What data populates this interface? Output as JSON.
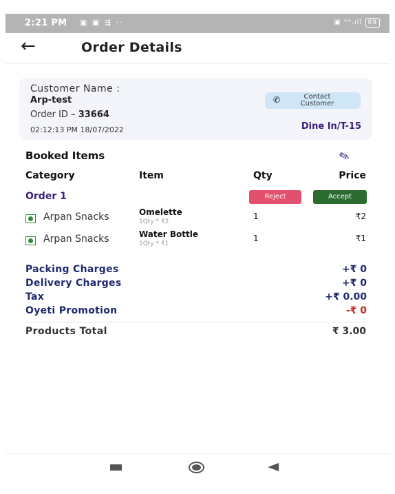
{
  "status_bar": {
    "time": "2:21 PM",
    "left_icons": "▣ ▣ ⇶ ··",
    "right_icons": "▣ ⁴ᴳ.ıll",
    "battery": "89"
  },
  "app_bar": {
    "back_icon": "arrow-left-icon",
    "title": "Order Details"
  },
  "customer_card": {
    "name_label": "Customer Name :",
    "name": "Arp-test",
    "order_id_label": "Order ID – ",
    "order_id": "33664",
    "datetime": "02:12:13 PM 18/07/2022",
    "contact_line1": "Contact",
    "contact_line2": "Customer",
    "dine": "Dine In/T-15"
  },
  "booked_items": {
    "title": "Booked Items",
    "headers": {
      "category": "Category",
      "item": "Item",
      "qty": "Qty",
      "price": "Price"
    },
    "order_label": "Order 1",
    "reject_label": "Reject",
    "accept_label": "Accept",
    "items": [
      {
        "vendor": "Arpan Snacks",
        "name": "Omelette",
        "sub": "1Qty * ₹2",
        "qty": "1",
        "price": "₹2"
      },
      {
        "vendor": "Arpan Snacks",
        "name": "Water Bottle",
        "sub": "1Qty * ₹1",
        "qty": "1",
        "price": "₹1"
      }
    ]
  },
  "charges": {
    "packing_label": "Packing Charges",
    "packing_value": "+₹ 0",
    "delivery_label": "Delivery Charges",
    "delivery_value": "+₹ 0",
    "tax_label": "Tax",
    "tax_value": "+₹ 0.00",
    "promo_label": "Oyeti Promotion",
    "promo_value": "-₹ 0"
  },
  "total": {
    "label": "Products Total",
    "value": "₹ 3.00"
  },
  "colors": {
    "brand": "#3a1f7a",
    "reject": "#e2506e",
    "accept": "#2b6b2f",
    "charges": "#1f2a6d",
    "negative": "#c62828"
  }
}
